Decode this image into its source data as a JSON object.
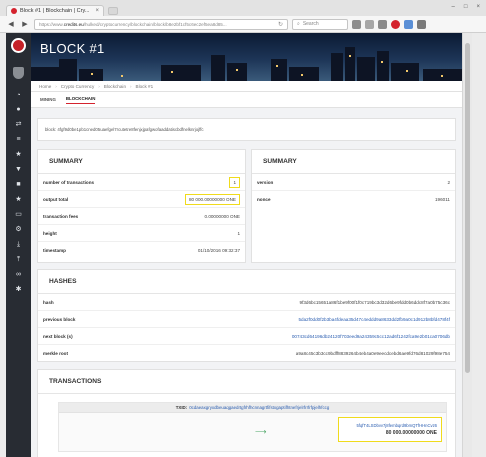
{
  "browser": {
    "tab_title": "Block #1 | Blockchain | Cry...",
    "tab_close": "×",
    "url_prefix": "https://www.",
    "url_domain": "credits.eu",
    "url_rest": "/hulked/cryptocurrency/blockchain/block/b8e2bf1cf5c6ec2ef5ea8d85...",
    "search_placeholder": "Search",
    "window_controls": [
      "–",
      "□",
      "×"
    ]
  },
  "page": {
    "title": "BLOCK #1",
    "breadcrumbs": [
      "Home",
      "Crypto Currency",
      "Blockchain",
      "Block #1"
    ],
    "tabs": [
      "MINING",
      "BLOCKCHAIN"
    ],
    "active_tab": "BLOCKCHAIN",
    "hash_line": "block: 4fgf9d0be1pb1cned05uaefgel7rcutetre8fenjxjpafgwofaaddatiscbdfnelknrjojffc"
  },
  "summary_left": {
    "title": "SUMMARY",
    "rows": [
      {
        "label": "number of transactions",
        "value": "1"
      },
      {
        "label": "output total",
        "value": "80 000.00000000 ONE"
      },
      {
        "label": "transaction fees",
        "value": "0.00000000 ONE"
      },
      {
        "label": "height",
        "value": "1"
      },
      {
        "label": "timestamp",
        "value": "01/10/2016 09:32:37"
      }
    ]
  },
  "summary_right": {
    "title": "SUMMARY",
    "rows": [
      {
        "label": "version",
        "value": "2"
      },
      {
        "label": "nonce",
        "value": "196011"
      }
    ]
  },
  "hashes": {
    "title": "HASHES",
    "rows": [
      {
        "label": "hash",
        "value": "9f3d6bc15651a86f1be9f00f1f0c719bc3d32d6be9fdd0b6ddc8f7a0b75c36c"
      },
      {
        "label": "previous block",
        "value": "5da2f0dd0f2b3ba4fdeaa35d47c4eddd9a8633dd2fb9a0c1d912b8bfd478f4f"
      },
      {
        "label": "next block (s)",
        "value": "00743cd64196db24120f703eed9a24359c5cc12ad6f1242fca9e2b01ca0706db"
      },
      {
        "label": "merkle root",
        "value": "a9a8c45c3b3cc9bdff8839264b4eb4a0e9eecdcebd6ae9fd76d81029f98e754"
      }
    ]
  },
  "transactions": {
    "title": "TRANSACTIONS",
    "txid_label": "TXID:",
    "txid_value": "0cdaeaxgryxdbeuaqgaedrtgfrhfhcnnagrtfifstxgaptifhtnefrjelrfrrfrfpjelhfccg",
    "output_address": "5fqfT4LSDbvv7j8fembqrd9bmQTfHHnCvz6",
    "output_amount": "80 000.00000000 ONE"
  },
  "colors": {
    "sidebar": "#282c33",
    "accent_red": "#d4232e",
    "highlight_yellow": "#f0db1c",
    "link_blue": "#2a5db0"
  },
  "icons": [
    "site-logo",
    "shield-icon",
    "history-icon",
    "user-icon",
    "arrows-icon",
    "list-icon",
    "star-icon",
    "cart-icon",
    "wallet-icon",
    "star-icon",
    "document-icon",
    "gear-icon",
    "download-icon",
    "upload-icon",
    "link-icon",
    "settings-icon"
  ]
}
